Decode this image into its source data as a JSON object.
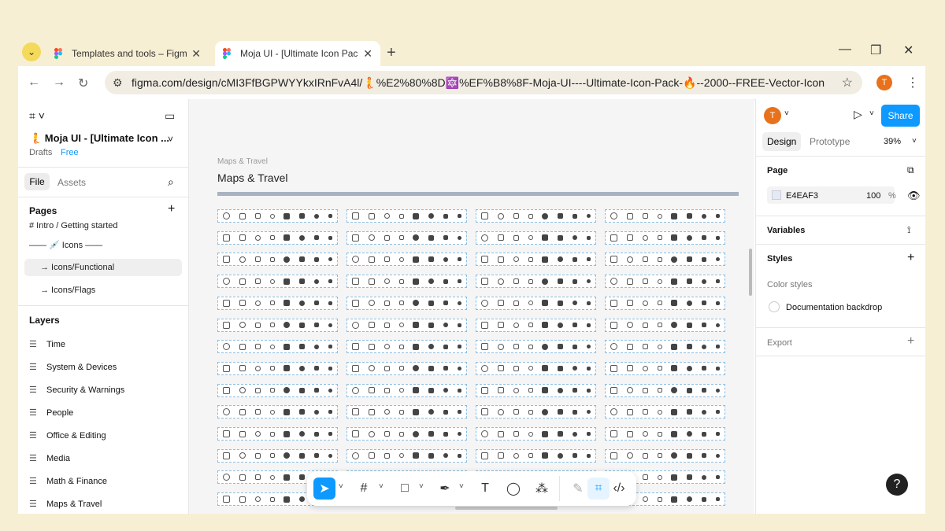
{
  "browser": {
    "tabs": [
      {
        "title": "Templates and tools – Figma",
        "active": false
      },
      {
        "title": "Moja UI - [Ultimate Icon Pack 🔥",
        "active": true
      }
    ],
    "url": "figma.com/design/cMI3FfBGPWYYkxIRnFvA4l/🧜%E2%80%8D🔯%EF%B8%8F-Moja-UI----Ultimate-Icon-Pack-🔥--2000--FREE-Vector-Icons--flags---brand-lo...",
    "profile_initial": "T"
  },
  "file": {
    "name": "🧜 Moja UI - [Ultimate Icon ...",
    "location": "Drafts",
    "plan": "Free",
    "tabs": [
      "File",
      "Assets"
    ]
  },
  "pages": {
    "heading": "Pages",
    "items": [
      {
        "label": "# Intro / Getting started",
        "selected": false
      },
      {
        "label": "—— 💉 Icons ——",
        "selected": false
      },
      {
        "label": "→ Icons/Functional",
        "selected": true
      },
      {
        "label": "→ Icons/Flags",
        "selected": false
      }
    ]
  },
  "layers": {
    "heading": "Layers",
    "items": [
      "Time",
      "System & Devices",
      "Security & Warnings",
      "People",
      "Office & Editing",
      "Media",
      "Math & Finance",
      "Maps & Travel"
    ]
  },
  "canvas": {
    "frame_label": "Maps & Travel",
    "frame_title": "Maps & Travel",
    "grid_rows": 14,
    "grid_cols": 4
  },
  "right_panel": {
    "tabs": [
      "Design",
      "Prototype"
    ],
    "zoom": "39%",
    "share_label": "Share",
    "page_heading": "Page",
    "page_color": "E4EAF3",
    "page_opacity": "100",
    "page_opacity_unit": "%",
    "variables_heading": "Variables",
    "styles_heading": "Styles",
    "color_styles_label": "Color styles",
    "color_style_name": "Documentation backdrop",
    "export_heading": "Export"
  },
  "colors": {
    "accent": "#0d99ff",
    "page_bg": "#f7efd4",
    "profile": "#e8711b"
  }
}
